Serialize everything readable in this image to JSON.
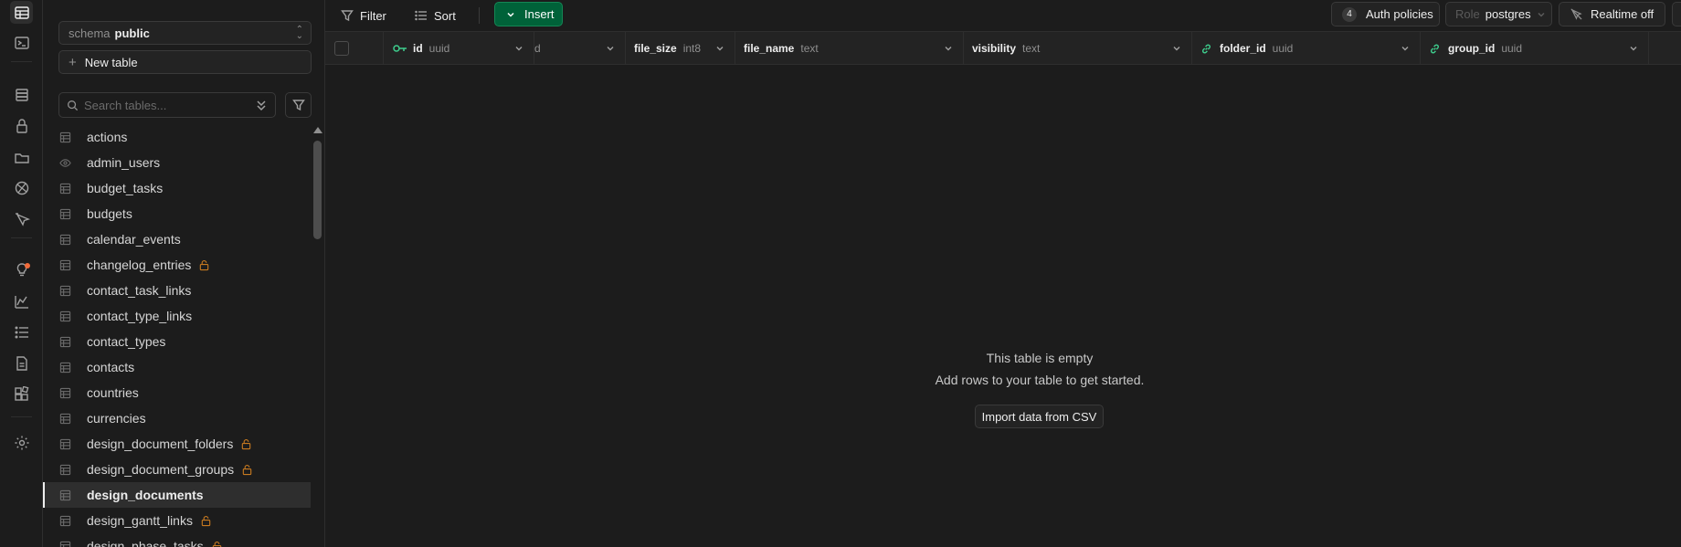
{
  "rail": {
    "icons": [
      "table-editor-icon",
      "sql-editor-icon",
      "database-icon",
      "auth-icon",
      "storage-icon",
      "realtime-icon",
      "edge-functions-icon",
      "advisors-icon",
      "reports-icon",
      "logs-icon",
      "api-docs-icon",
      "integrations-icon",
      "settings-icon"
    ]
  },
  "sidebar": {
    "schema_label": "schema",
    "schema_value": "public",
    "new_table_label": "New table",
    "search_placeholder": "Search tables...",
    "tables": [
      {
        "name": "actions",
        "icon": "table",
        "locked": false
      },
      {
        "name": "admin_users",
        "icon": "view",
        "locked": false
      },
      {
        "name": "budget_tasks",
        "icon": "table",
        "locked": false
      },
      {
        "name": "budgets",
        "icon": "table",
        "locked": false
      },
      {
        "name": "calendar_events",
        "icon": "table",
        "locked": false
      },
      {
        "name": "changelog_entries",
        "icon": "table",
        "locked": true
      },
      {
        "name": "contact_task_links",
        "icon": "table",
        "locked": false
      },
      {
        "name": "contact_type_links",
        "icon": "table",
        "locked": false
      },
      {
        "name": "contact_types",
        "icon": "table",
        "locked": false
      },
      {
        "name": "contacts",
        "icon": "table",
        "locked": false
      },
      {
        "name": "countries",
        "icon": "table",
        "locked": false
      },
      {
        "name": "currencies",
        "icon": "table",
        "locked": false
      },
      {
        "name": "design_document_folders",
        "icon": "table",
        "locked": true
      },
      {
        "name": "design_document_groups",
        "icon": "table",
        "locked": true
      },
      {
        "name": "design_documents",
        "icon": "table",
        "locked": false,
        "active": true
      },
      {
        "name": "design_gantt_links",
        "icon": "table",
        "locked": true
      },
      {
        "name": "design_phase_tasks",
        "icon": "table",
        "locked": true
      }
    ]
  },
  "toolbar": {
    "filter_label": "Filter",
    "sort_label": "Sort",
    "insert_label": "Insert",
    "auth_policies_count": "4",
    "auth_policies_label": "Auth policies",
    "role_label": "Role",
    "role_value": "postgres",
    "realtime_label": "Realtime off"
  },
  "grid": {
    "columns": [
      {
        "name": "id",
        "type": "uuid",
        "icon": "key"
      },
      {
        "name": "",
        "type": "d",
        "icon": ""
      },
      {
        "name": "file_size",
        "type": "int8",
        "icon": ""
      },
      {
        "name": "file_name",
        "type": "text",
        "icon": ""
      },
      {
        "name": "visibility",
        "type": "text",
        "icon": ""
      },
      {
        "name": "folder_id",
        "type": "uuid",
        "icon": "link"
      },
      {
        "name": "group_id",
        "type": "uuid",
        "icon": "link"
      }
    ]
  },
  "empty_state": {
    "title": "This table is empty",
    "subtitle": "Add rows to your table to get started.",
    "import_label": "Import data from CSV"
  },
  "colors": {
    "accent": "#3ecf8e",
    "insert_bg": "#006239",
    "lock": "#c87a20",
    "background": "#1c1c1c"
  }
}
